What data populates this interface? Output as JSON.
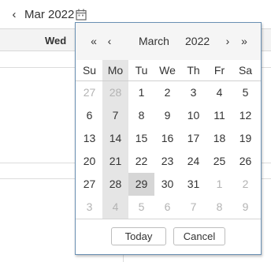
{
  "scheduler": {
    "nav_prev": "‹",
    "current_label": "Mar 2022",
    "calendar_icon": "calendar-icon",
    "header_day": "Wed"
  },
  "picker": {
    "prev_year": "«",
    "prev_month": "‹",
    "month": "March",
    "year": "2022",
    "next_month": "›",
    "next_year": "»",
    "weekdays": [
      "Su",
      "Mo",
      "Tu",
      "We",
      "Th",
      "Fr",
      "Sa"
    ],
    "highlight_weekday_index": 1,
    "weeks": [
      [
        {
          "d": "27",
          "o": true
        },
        {
          "d": "28",
          "o": true
        },
        {
          "d": "1"
        },
        {
          "d": "2"
        },
        {
          "d": "3"
        },
        {
          "d": "4"
        },
        {
          "d": "5"
        }
      ],
      [
        {
          "d": "6"
        },
        {
          "d": "7"
        },
        {
          "d": "8"
        },
        {
          "d": "9"
        },
        {
          "d": "10"
        },
        {
          "d": "11"
        },
        {
          "d": "12"
        }
      ],
      [
        {
          "d": "13"
        },
        {
          "d": "14"
        },
        {
          "d": "15"
        },
        {
          "d": "16"
        },
        {
          "d": "17"
        },
        {
          "d": "18"
        },
        {
          "d": "19"
        }
      ],
      [
        {
          "d": "20"
        },
        {
          "d": "21"
        },
        {
          "d": "22"
        },
        {
          "d": "23"
        },
        {
          "d": "24"
        },
        {
          "d": "25"
        },
        {
          "d": "26"
        }
      ],
      [
        {
          "d": "27"
        },
        {
          "d": "28"
        },
        {
          "d": "29",
          "t": true
        },
        {
          "d": "30"
        },
        {
          "d": "31"
        },
        {
          "d": "1",
          "o": true
        },
        {
          "d": "2",
          "o": true
        }
      ],
      [
        {
          "d": "3",
          "o": true
        },
        {
          "d": "4",
          "o": true
        },
        {
          "d": "5",
          "o": true
        },
        {
          "d": "6",
          "o": true
        },
        {
          "d": "7",
          "o": true
        },
        {
          "d": "8",
          "o": true
        },
        {
          "d": "9",
          "o": true
        }
      ]
    ],
    "today_button": "Today",
    "cancel_button": "Cancel"
  },
  "colors": {
    "popup_border": "#6a90b3",
    "highlight_bg": "#e5e5e5",
    "selected_bg": "#d6d6d6",
    "other_month_text": "#b3b3b3"
  }
}
